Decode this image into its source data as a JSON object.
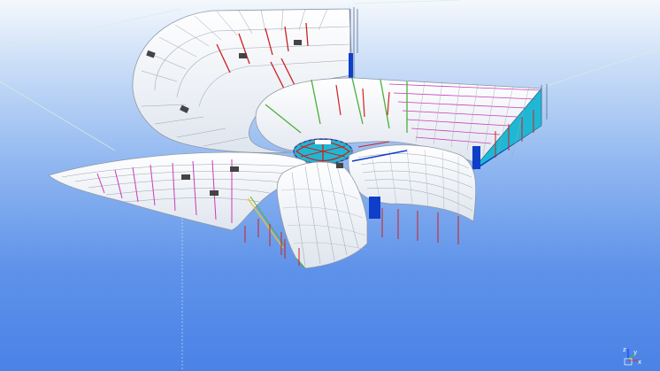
{
  "viewport": {
    "title": "",
    "background_top": "#f4f8fd",
    "background_bottom": "#4a82e6"
  },
  "model": {
    "type": "stadium-roof-steel-structure",
    "petals": 5,
    "colors": {
      "cladding": "#ffffff",
      "rib_line": "#8f9aa8",
      "primary_member": "#d01f1f",
      "secondary_member": "#c93bb8",
      "green_member": "#4caf3a",
      "blue_member": "#0f3ec9",
      "cyan_panel": "#1fb8d4",
      "orange_member": "#e08a20",
      "dark_plate": "#444444"
    }
  },
  "axis_triad": {
    "x_label": "x",
    "y_label": "y",
    "z_label": "z",
    "colors": {
      "x": "#e03030",
      "y": "#30c030",
      "z": "#2040ff"
    }
  }
}
